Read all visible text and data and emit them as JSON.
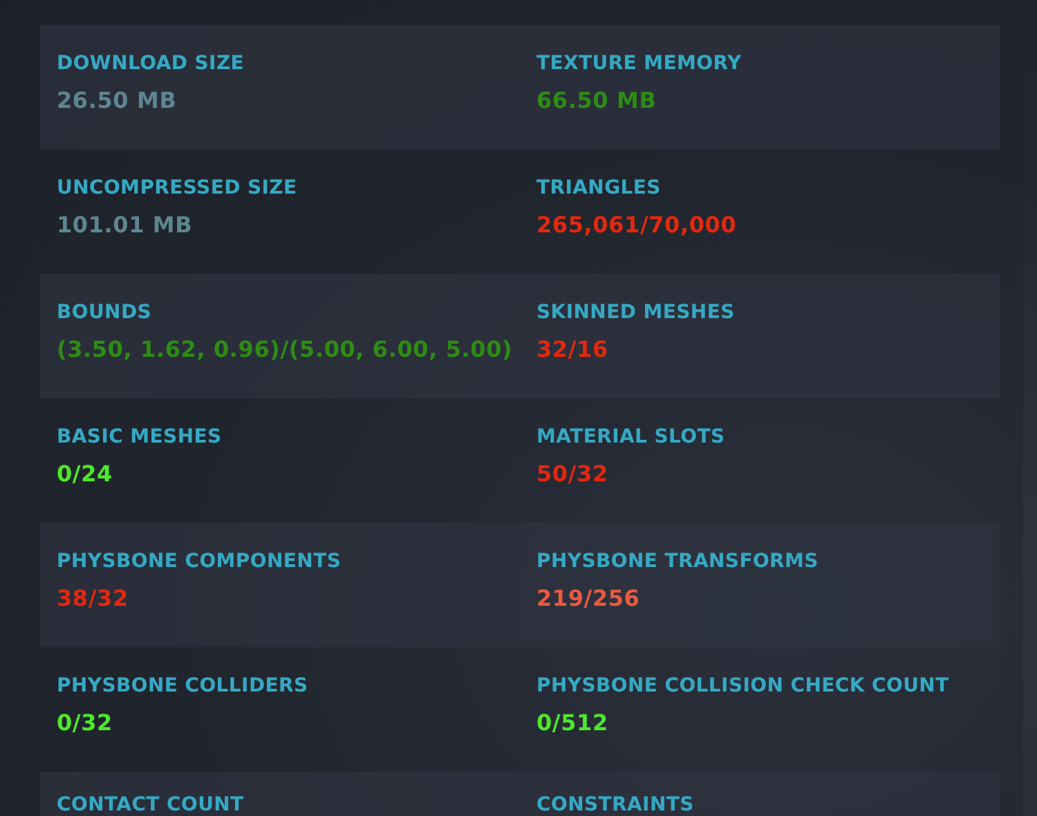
{
  "rows": [
    {
      "stats": [
        {
          "label": "DOWNLOAD SIZE",
          "value": "26.50 MB",
          "color": "#5e8690"
        },
        {
          "label": "TEXTURE MEMORY",
          "value": "66.50 MB",
          "color": "#2e8c14"
        }
      ]
    },
    {
      "stats": [
        {
          "label": "UNCOMPRESSED SIZE",
          "value": "101.01 MB",
          "color": "#5e8690"
        },
        {
          "label": "TRIANGLES",
          "value": "265,061/70,000",
          "color": "#e2280e"
        }
      ]
    },
    {
      "stats": [
        {
          "label": "BOUNDS",
          "value": "(3.50, 1.62, 0.96)/(5.00, 6.00, 5.00)",
          "color": "#2e8c14"
        },
        {
          "label": "SKINNED MESHES",
          "value": "32/16",
          "color": "#e2280e"
        }
      ]
    },
    {
      "stats": [
        {
          "label": "BASIC MESHES",
          "value": "0/24",
          "color": "#4ee82a"
        },
        {
          "label": "MATERIAL SLOTS",
          "value": "50/32",
          "color": "#e2280e"
        }
      ]
    },
    {
      "stats": [
        {
          "label": "PHYSBONE COMPONENTS",
          "value": "38/32",
          "color": "#e2280e"
        },
        {
          "label": "PHYSBONE TRANSFORMS",
          "value": "219/256",
          "color": "#ea5a40"
        }
      ]
    },
    {
      "stats": [
        {
          "label": "PHYSBONE COLLIDERS",
          "value": "0/32",
          "color": "#4ee82a"
        },
        {
          "label": "PHYSBONE COLLISION CHECK COUNT",
          "value": "0/512",
          "color": "#4ee82a"
        }
      ]
    },
    {
      "stats": [
        {
          "label": "CONTACT COUNT"
        },
        {
          "label": "CONSTRAINTS"
        }
      ]
    }
  ]
}
